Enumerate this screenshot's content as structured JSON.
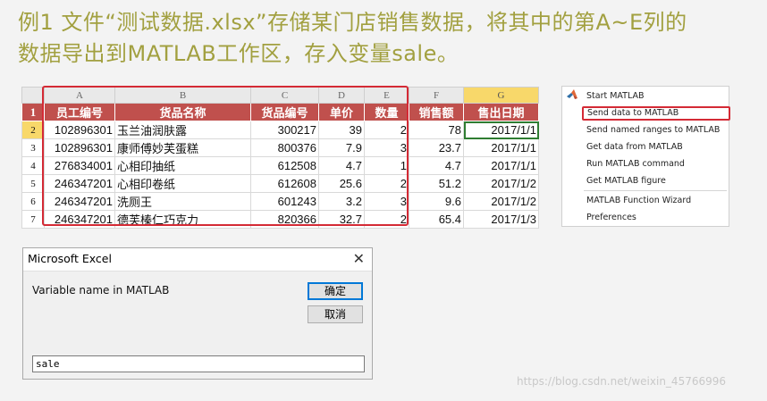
{
  "title": {
    "line1": "例1 文件“测试数据.xlsx”存储某门店销售数据，将其中的第A~E列的",
    "line2": "数据导出到MATLAB工作区，存入变量sale。"
  },
  "sheet": {
    "col_letters": [
      "A",
      "B",
      "C",
      "D",
      "E",
      "F",
      "G"
    ],
    "header_row_number": "1",
    "headers": [
      "员工编号",
      "货品名称",
      "货品编号",
      "单价",
      "数量",
      "销售额",
      "售出日期"
    ],
    "rows": [
      {
        "row": "2",
        "cells": [
          "102896301",
          "玉兰油润肤露",
          "300217",
          "39",
          "2",
          "78",
          "2017/1/1"
        ]
      },
      {
        "row": "3",
        "cells": [
          "102896301",
          "康师傅妙芙蛋糕",
          "800376",
          "7.9",
          "3",
          "23.7",
          "2017/1/1"
        ]
      },
      {
        "row": "4",
        "cells": [
          "276834001",
          "心相印抽纸",
          "612508",
          "4.7",
          "1",
          "4.7",
          "2017/1/1"
        ]
      },
      {
        "row": "5",
        "cells": [
          "246347201",
          "心相印卷纸",
          "612608",
          "25.6",
          "2",
          "51.2",
          "2017/1/2"
        ]
      },
      {
        "row": "6",
        "cells": [
          "246347201",
          "洗厕王",
          "601243",
          "3.2",
          "3",
          "9.6",
          "2017/1/2"
        ]
      },
      {
        "row": "7",
        "cells": [
          "246347201",
          "德芙榛仁巧克力",
          "820366",
          "32.7",
          "2",
          "65.4",
          "2017/1/3"
        ]
      }
    ]
  },
  "menu": {
    "items": [
      "Start MATLAB",
      "Send data to MATLAB",
      "Send named ranges to MATLAB",
      "Get data from MATLAB",
      "Run MATLAB command",
      "Get MATLAB figure",
      "MATLAB Function Wizard",
      "Preferences"
    ]
  },
  "dialog": {
    "title": "Microsoft Excel",
    "close": "✕",
    "prompt": "Variable name in MATLAB",
    "ok": "确定",
    "cancel": "取消",
    "input_value": "sale"
  },
  "watermark": "https://blog.csdn.net/weixin_45766996",
  "colors": {
    "title": "#a2a040",
    "header_fill": "#c0504d",
    "highlight": "#d42a35"
  }
}
